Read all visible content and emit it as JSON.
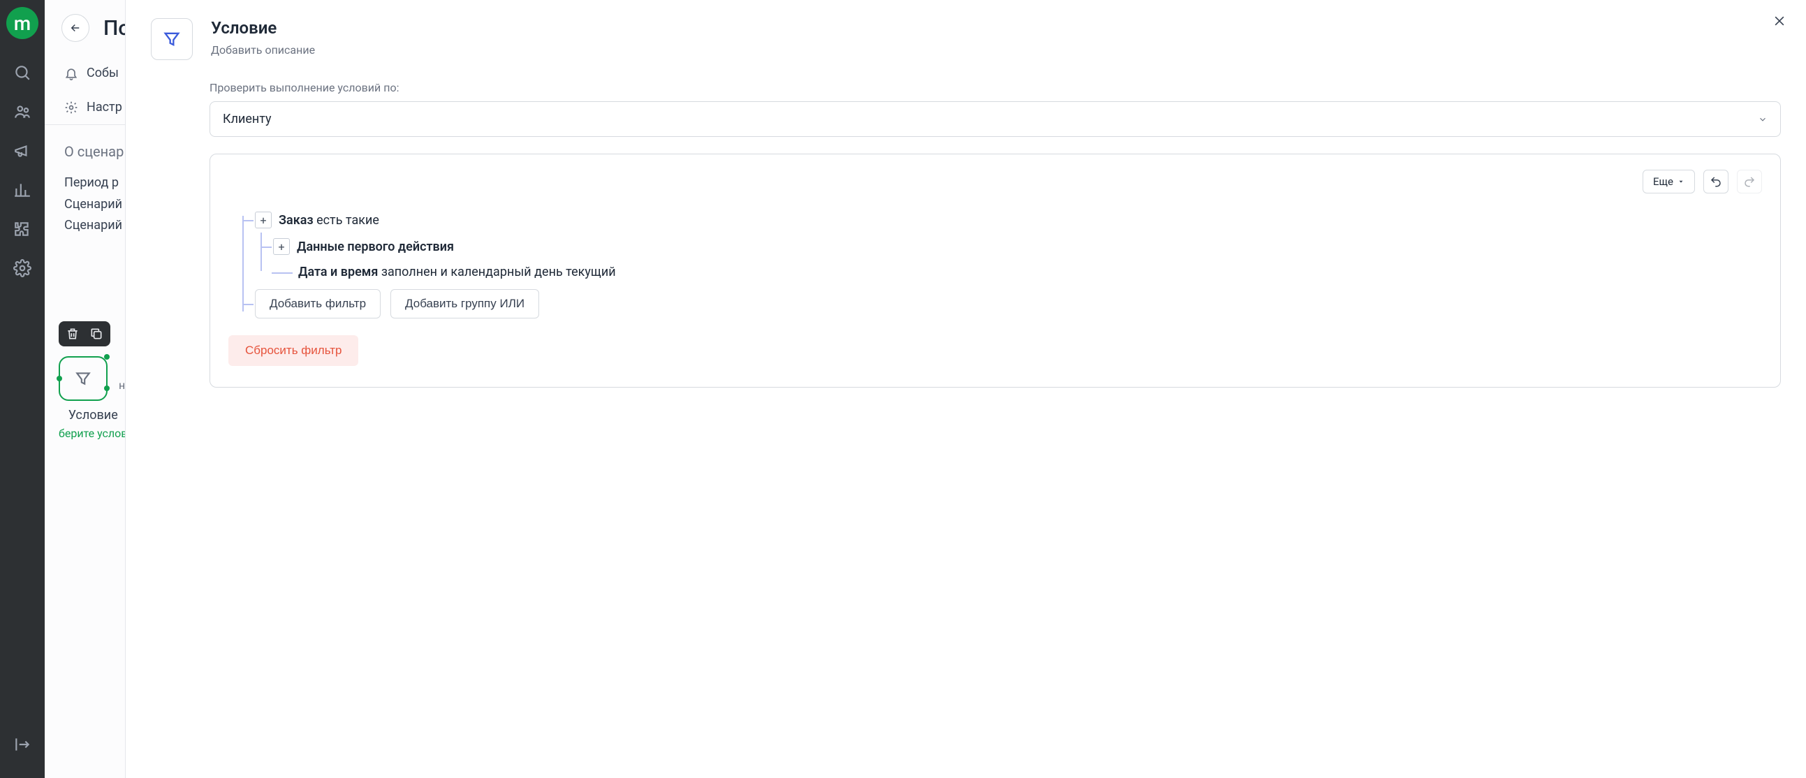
{
  "rail": {
    "logo_letter": "m"
  },
  "back": {
    "title": "По",
    "tabs": {
      "events": "Собы",
      "settings": "Настр"
    },
    "canvas": {
      "heading": "О сценар",
      "row1": "Период р",
      "row2": "Сценарий",
      "row3": "Сценарий"
    }
  },
  "node": {
    "side_text": "не",
    "label": "Условие",
    "sublabel": "берите услов"
  },
  "main": {
    "title": "Условие",
    "add_desc": "Добавить описание",
    "check_label": "Проверить выполнение условий по:",
    "select_value": "Клиенту",
    "more_btn": "Еще",
    "filter": {
      "order_bold": "Заказ",
      "order_rest": "есть такие",
      "data_first": "Данные первого действия",
      "datetime_bold": "Дата и время",
      "datetime_rest": "заполнен и календарный день текущий",
      "add_filter": "Добавить фильтр",
      "add_group": "Добавить группу ИЛИ",
      "reset": "Сбросить фильтр"
    }
  }
}
